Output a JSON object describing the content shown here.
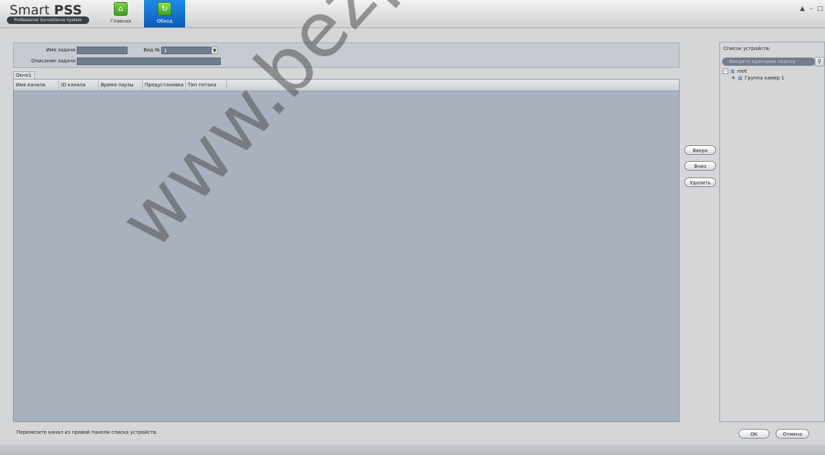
{
  "app": {
    "logo_main": "Smart ",
    "logo_bold": "PSS",
    "logo_sub": "Professional Surveillance System"
  },
  "nav": {
    "home_label": "Главная",
    "tour_label": "Обход",
    "home_icon": "house-icon",
    "tour_icon": "tour-icon"
  },
  "window_controls": {
    "lock": "🔒",
    "minimize": "–",
    "maximize": "▫"
  },
  "task": {
    "name_label": "Имя задачи",
    "name_value": "",
    "view_label": "Вид №",
    "view_value": "1",
    "desc_label": "Описание задачи",
    "desc_value": ""
  },
  "window_tab": "Окно1",
  "table": {
    "columns": [
      "Имя канала",
      "ID канала",
      "Время паузы",
      "Предустановка",
      "Тип потока"
    ]
  },
  "side_buttons": {
    "up": "Вверх",
    "down": "Вниз",
    "delete": "Удалить"
  },
  "device_panel": {
    "title": "Список устройств:",
    "search_placeholder": "Введите критерии поиска",
    "tree": [
      {
        "label": "root",
        "toggle": "−"
      },
      {
        "label": "Группа камер 1",
        "toggle": "+"
      }
    ]
  },
  "hint": "Перенесите канал из правой панели списка устройств.",
  "footer": {
    "ok": "ОК",
    "cancel": "Отмена"
  },
  "watermark": "www.bezpeka-shop"
}
